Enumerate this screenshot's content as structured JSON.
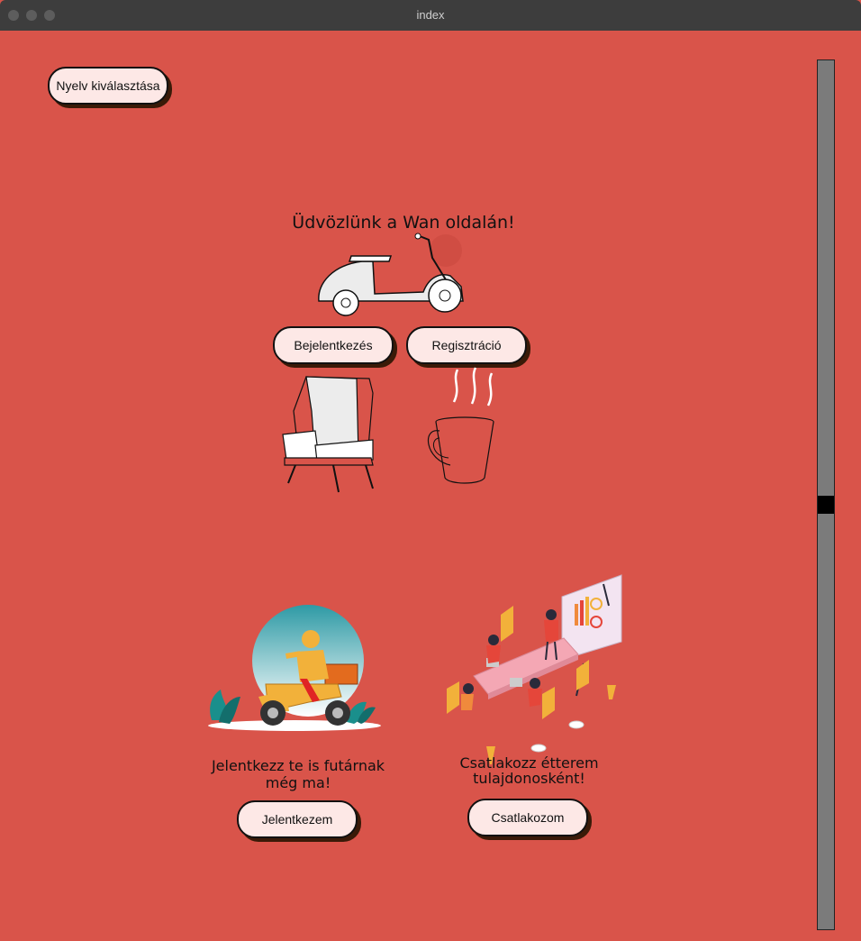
{
  "window": {
    "title": "index"
  },
  "language_button": {
    "label": "Nyelv kiválasztása"
  },
  "hero": {
    "title": "Üdvözlünk a Wan oldalán!",
    "login_label": "Bejelentkezés",
    "register_label": "Regisztráció"
  },
  "courier": {
    "text": "Jelentkezz te is futárnak még ma!",
    "button_label": "Jelentkezem"
  },
  "restaurant": {
    "text": "Csatlakozz étterem tulajdonosként!",
    "button_label": "Csatlakozom"
  },
  "colors": {
    "background": "#d9544a",
    "button_fill": "#fde8e6",
    "button_shadow": "#3a1a08",
    "scrollbar": "#7b7b7b"
  },
  "icons": [
    "scooter-icon",
    "armchair-icon",
    "coffee-cup-icon",
    "courier-illustration",
    "meeting-illustration"
  ]
}
